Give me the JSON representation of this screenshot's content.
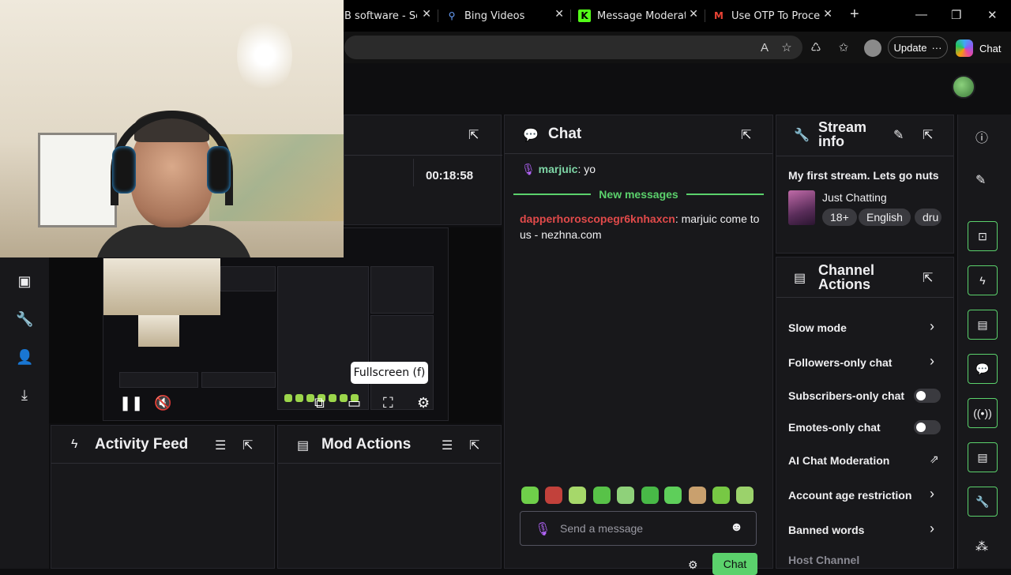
{
  "browser": {
    "tabs": [
      {
        "label": "B software - Searc",
        "icon": "search-icon"
      },
      {
        "label": "Bing Videos",
        "icon": "search-icon"
      },
      {
        "label": "Message Moderation",
        "icon": "kick-icon"
      },
      {
        "label": "Use OTP To Proceed",
        "icon": "gmail-icon"
      }
    ],
    "new_tab": "+",
    "update_label": "Update",
    "chat_label": "Chat"
  },
  "stream": {
    "uptime": "00:18:58"
  },
  "player": {
    "tooltip": "Fullscreen (f)"
  },
  "chat": {
    "title": "Chat",
    "messages": [
      {
        "user": "marjuic",
        "text": ": yo"
      },
      {
        "user": "dapperhoroscopegr6knhaxcn",
        "text": ": marjuic come to us - nezhna.com"
      }
    ],
    "new_messages_label": "New messages",
    "input_placeholder": "Send a message",
    "send_label": "Chat"
  },
  "stream_info": {
    "title": "Stream info",
    "stream_title": "My first stream. Lets go nuts",
    "category": "Just Chatting",
    "tags": [
      "18+",
      "English",
      "dru"
    ]
  },
  "channel_actions": {
    "title": "Channel Actions",
    "items": [
      {
        "label": "Slow mode",
        "control": "chevron"
      },
      {
        "label": "Followers-only chat",
        "control": "chevron"
      },
      {
        "label": "Subscribers-only chat",
        "control": "toggle"
      },
      {
        "label": "Emotes-only chat",
        "control": "toggle"
      },
      {
        "label": "AI Chat Moderation",
        "control": "external"
      },
      {
        "label": "Account age restriction",
        "control": "chevron"
      },
      {
        "label": "Banned words",
        "control": "chevron"
      },
      {
        "label": "Host Channel",
        "control": "none"
      }
    ]
  },
  "activity_feed": {
    "title": "Activity Feed"
  },
  "mod_actions": {
    "title": "Mod Actions"
  },
  "colors": {
    "accent": "#5bd16c",
    "background": "#0e0e10",
    "panel": "#18181b",
    "username_green": "#7ed6a6",
    "username_red": "#e14a4a"
  }
}
